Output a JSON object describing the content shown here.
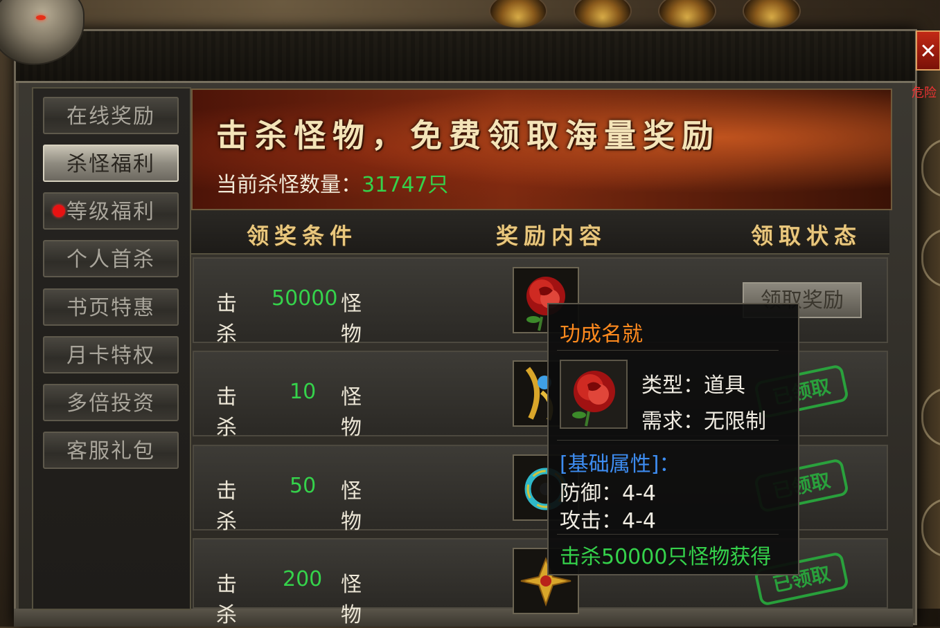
{
  "window": {
    "close_icon": "close-icon",
    "side_tag": "危险"
  },
  "menu": {
    "items": [
      {
        "label": "在线奖励",
        "active": false,
        "dot": false
      },
      {
        "label": "杀怪福利",
        "active": true,
        "dot": false
      },
      {
        "label": "等级福利",
        "active": false,
        "dot": true
      },
      {
        "label": "个人首杀",
        "active": false,
        "dot": false
      },
      {
        "label": "书页特惠",
        "active": false,
        "dot": false
      },
      {
        "label": "月卡特权",
        "active": false,
        "dot": false
      },
      {
        "label": "多倍投资",
        "active": false,
        "dot": false
      },
      {
        "label": "客服礼包",
        "active": false,
        "dot": false
      }
    ]
  },
  "banner": {
    "title": "击杀怪物，免费领取海量奖励",
    "kill_count_label": "当前杀怪数量：",
    "kill_count_value": "31747只"
  },
  "table": {
    "headers": [
      "领奖条件",
      "奖励内容",
      "领取状态"
    ],
    "rows": [
      {
        "prefix": "击杀",
        "count": "50000",
        "suffix": "怪物",
        "item_icon": "red-rose-icon",
        "status": "领取奖励",
        "status_type": "button"
      },
      {
        "prefix": "击杀",
        "count": "10",
        "suffix": "怪物",
        "item_icon": "gold-blue-ornament-icon",
        "status": "已领取",
        "status_type": "stamp"
      },
      {
        "prefix": "击杀",
        "count": "50",
        "suffix": "怪物",
        "item_icon": "green-ring-icon",
        "status": "已领取",
        "status_type": "stamp"
      },
      {
        "prefix": "击杀",
        "count": "200",
        "suffix": "怪物",
        "item_icon": "gold-star-ornament-icon",
        "status": "已领取",
        "status_type": "stamp"
      }
    ]
  },
  "tooltip": {
    "name": "功成名就",
    "icon": "red-rose-icon",
    "type_line": "类型：道具",
    "require_line": "需求：无限制",
    "attr_header": "[基础属性]：",
    "defense_line": "防御：4-4",
    "attack_line": "攻击：4-4",
    "source": "击杀50000只怪物获得"
  },
  "colors": {
    "accent_green": "#35d24b",
    "tooltip_name": "#ff8a1e",
    "attr_blue": "#3d8cf0",
    "header_gold": "#e9c77d"
  }
}
